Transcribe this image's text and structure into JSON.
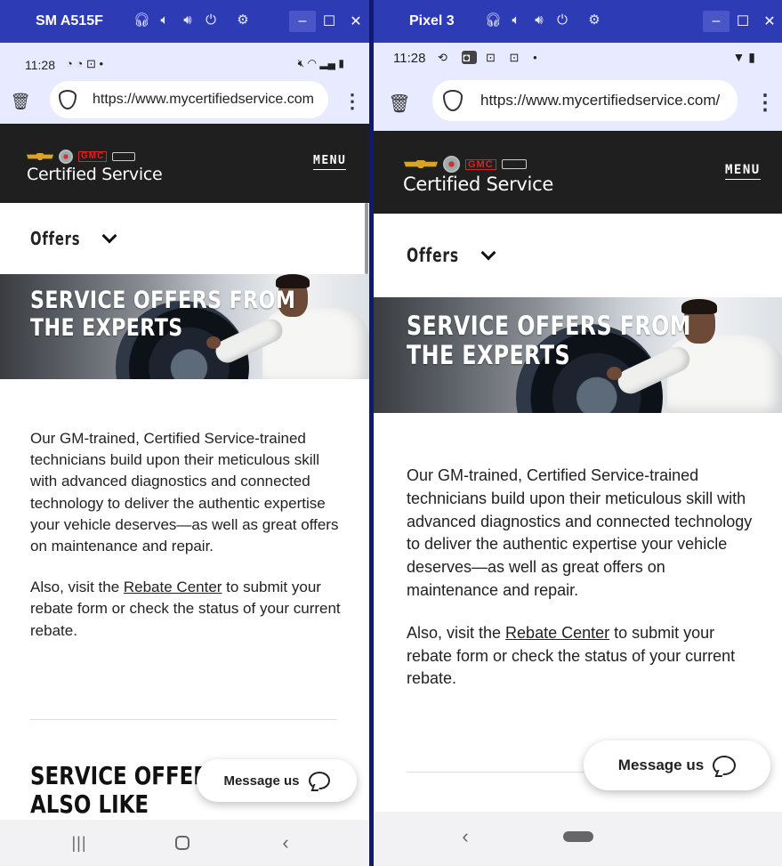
{
  "left": {
    "device_name": "SM A515F",
    "status_time": "11:28",
    "status_left_icons": [
      "sync-icon",
      "sync-icon",
      "clock-icon",
      "dot-icon"
    ],
    "status_right_icons": [
      "mute-icon",
      "wifi-icon",
      "signal-icon",
      "battery-icon"
    ],
    "url": "https://www.mycertifiedservice.com",
    "brand_title": "Certified Service",
    "menu_label": "MENU",
    "offers_label": "Offers",
    "hero_heading_line1": "SERVICE OFFERS FROM",
    "hero_heading_line2": "THE EXPERTS",
    "paragraph1": "Our GM-trained, Certified Service-trained technicians build upon their meticulous skill with advanced diagnostics and connected technology to deliver the authentic expertise your vehicle deserves—as well as great offers on maintenance and repair.",
    "para2_prefix": "Also, visit the ",
    "para2_link": "Rebate Center",
    "para2_suffix": " to submit your rebate form or check the status of your current rebate.",
    "section_heading_line1": "SERVICE OFFERS",
    "section_heading_line2": "ALSO LIKE",
    "message_label": "Message us"
  },
  "right": {
    "device_name": "Pixel 3",
    "status_time": "11:28",
    "status_left_icons": [
      "sync-icon",
      "app-icon",
      "clock-icon",
      "clock-icon",
      "dot-icon"
    ],
    "status_right_icons": [
      "wifi-icon",
      "battery-icon"
    ],
    "url": "https://www.mycertifiedservice.com/",
    "brand_title": "Certified Service",
    "menu_label": "MENU",
    "offers_label": "Offers",
    "hero_heading_line1": "SERVICE OFFERS FROM",
    "hero_heading_line2": "THE EXPERTS",
    "paragraph1": "Our GM-trained, Certified Service-trained technicians build upon their meticulous skill with advanced diagnostics and connected technology to deliver the authentic expertise your vehicle deserves—as well as great offers on maintenance and repair.",
    "para2_prefix": "Also, visit the ",
    "para2_link": "Rebate Center",
    "para2_suffix": " to submit your rebate form or check the status of your current rebate.",
    "message_label": "Message us"
  },
  "colors": {
    "titlebar": "#2d3bb5",
    "browser_chrome": "#e8ebff",
    "site_header": "#1f1f1f",
    "chevy_gold": "#d9a326",
    "gmc_red": "#d22222"
  }
}
